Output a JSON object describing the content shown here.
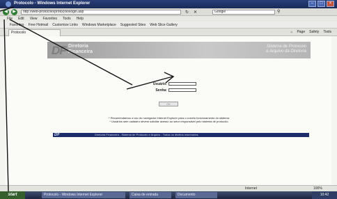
{
  "window": {
    "title": "Protocolo - Windows Internet Explorer"
  },
  "addressbar": {
    "url": "http://web-protocolo/protocolo/login.asp",
    "search_placeholder": "Google"
  },
  "menubar": {
    "items": [
      "File",
      "Edit",
      "View",
      "Favorites",
      "Tools",
      "Help"
    ]
  },
  "favorites": {
    "items": [
      "Favorites",
      "Free Hotmail",
      "Customize Links",
      "Windows Marketplace",
      "Suggested Sites",
      "Web Slice Gallery"
    ]
  },
  "tab": {
    "label": "Protocolo"
  },
  "commandbar": {
    "items": [
      "Page",
      "Safety",
      "Tools"
    ]
  },
  "banner": {
    "logo": "DF",
    "org_line1": "Diretoria",
    "org_line2": "Financeira",
    "system_line1": "Sistema de Protocolo",
    "system_line2": "e Arquivo da Diretoria"
  },
  "login": {
    "user_label": "Usuário:",
    "password_label": "Senha:",
    "ok_label": "OK"
  },
  "notes": {
    "line1": "* Recomendamos o uso do navegador Internet Explorer para o correto funcionamento do sistema.",
    "line2": "* Usuários sem cadastro devem solicitar acesso ao setor responsável pelo sistema de protocolo."
  },
  "footer": {
    "logo": "DF",
    "text": "Diretoria Financeira - Sistema de Protocolo e Arquivo - Todos os direitos reservados"
  },
  "statusbar": {
    "zone": "Internet",
    "zoom": "100%"
  },
  "taskbar": {
    "start": "start",
    "tasks": [
      "Protocolo - Windows Internet Explorer",
      "Caixa de entrada",
      "Documento"
    ],
    "clock": "10:42"
  }
}
